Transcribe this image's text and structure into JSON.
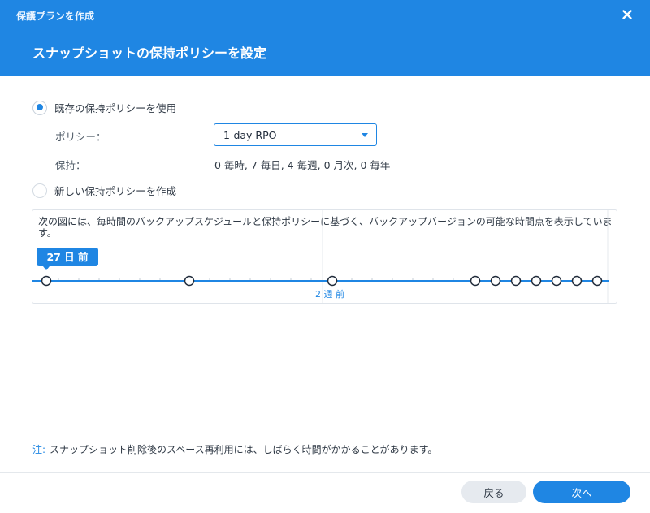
{
  "window": {
    "title": "保護プランを作成",
    "dialog_title": "スナップショットの保持ポリシーを設定"
  },
  "options": {
    "use_existing_label": "既存の保持ポリシーを使用",
    "create_new_label": "新しい保持ポリシーを作成",
    "selected": "use_existing"
  },
  "policy": {
    "label": "ポリシー：",
    "selected_value": "1-day RPO"
  },
  "retention": {
    "label": "保持：",
    "value": "0 毎時, 7 毎日, 4 毎週, 0 月次, 0 毎年"
  },
  "timeline": {
    "description": "次の図には、毎時間のバックアップスケジュールと保持ポリシーに基づく、バックアップバージョンの可能な時間点を表示しています。",
    "tooltip": "27 日 前",
    "marker_label": "2 週 前",
    "accent_color": "#1f86e3"
  },
  "note": {
    "label": "注:",
    "text": "スナップショット削除後のスペース再利用には、しばらく時間がかかることがあります。"
  },
  "footer": {
    "back_label": "戻る",
    "next_label": "次へ"
  }
}
